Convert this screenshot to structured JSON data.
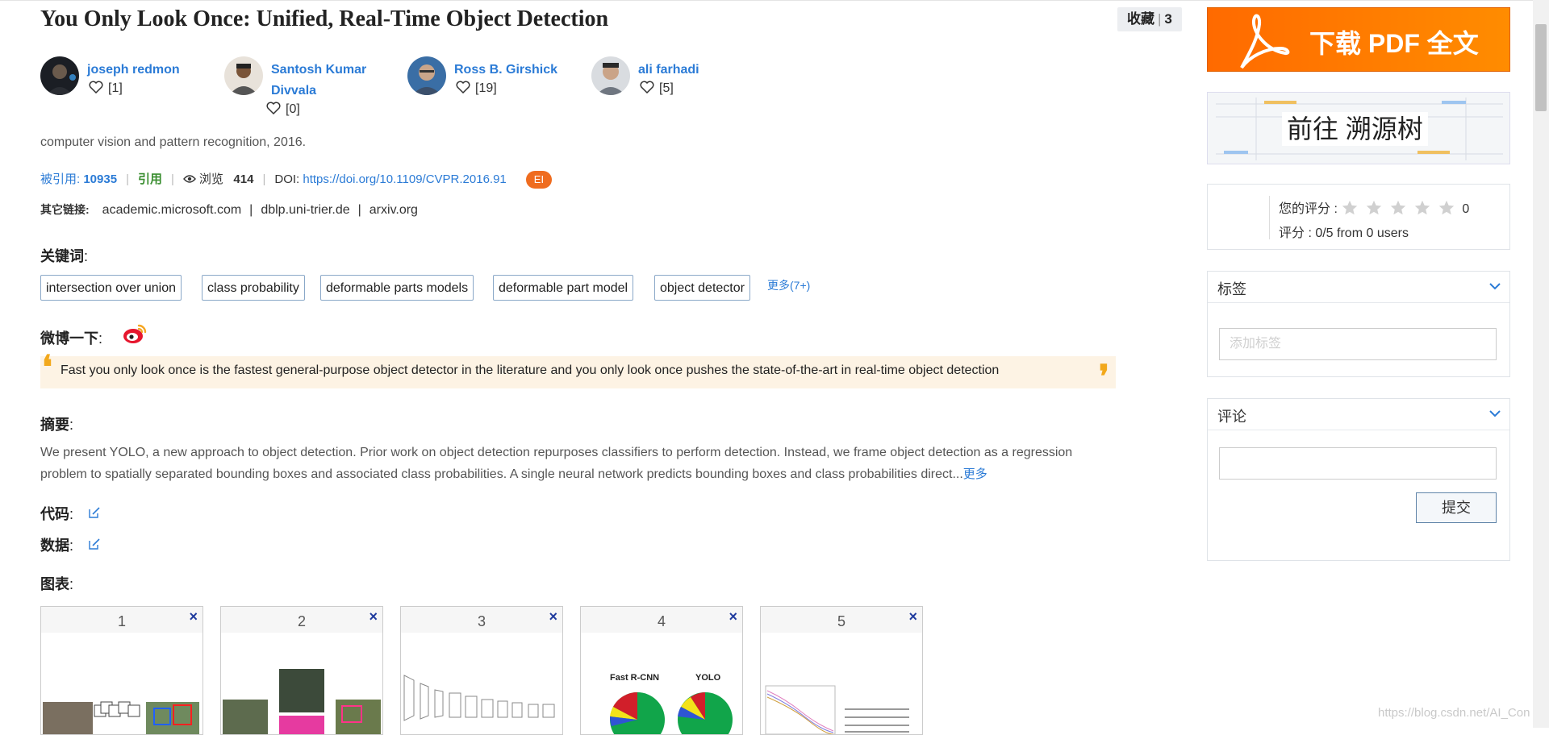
{
  "paper": {
    "title": "You Only Look Once: Unified, Real-Time Object Detection",
    "venue": "computer vision and pattern recognition, 2016."
  },
  "favorite": {
    "label": "收藏",
    "separator": "|",
    "count": "3"
  },
  "authors": [
    {
      "name_line1": "joseph redmon",
      "name_line2": "",
      "likes": "[1]"
    },
    {
      "name_line1": "Santosh Kumar",
      "name_line2": "Divvala",
      "likes": "[0]"
    },
    {
      "name_line1": "Ross B. Girshick",
      "name_line2": "",
      "likes": "[19]"
    },
    {
      "name_line1": "ali farhadi",
      "name_line2": "",
      "likes": "[5]"
    }
  ],
  "meta": {
    "cited_label": "被引用:",
    "cited_count": "10935",
    "cite_label": "引用",
    "views_label": "浏览",
    "views_count": "414",
    "doi_label": "DOI:",
    "doi_url": "https://doi.org/10.1109/CVPR.2016.91",
    "index_badge": "EI",
    "separator": "|"
  },
  "other_links": {
    "label": "其它链接:",
    "items": [
      "academic.microsoft.com",
      "dblp.uni-trier.de",
      "arxiv.org"
    ],
    "separator": "|"
  },
  "keywords": {
    "label": "关键词",
    "items": [
      "intersection over union",
      "class probability",
      "deformable parts models",
      "deformable part model",
      "object detector"
    ],
    "more": "更多(7+)"
  },
  "weibo": {
    "label": "微博一下",
    "icon": "weibo-icon",
    "quote": "Fast you only look once is the fastest general-purpose object detector in the literature and you only look once pushes the state-of-the-art in real-time object detection",
    "open_mark": "❛",
    "close_mark": "❜"
  },
  "abstract": {
    "label": "摘要",
    "line1": "We present YOLO, a new approach to object detection. Prior work on object detection repurposes classifiers to perform detection. Instead, we frame object detection as a regression",
    "line2": "problem to spatially separated bounding boxes and associated class probabilities. A single neural network predicts bounding boxes and class probabilities direct...",
    "more": "更多"
  },
  "code": {
    "label": "代码"
  },
  "dataset": {
    "label": "数据"
  },
  "figures": {
    "label": "图表",
    "close_glyph": "×",
    "items": [
      "1",
      "2",
      "3",
      "4",
      "5"
    ],
    "fig4": {
      "left_label": "Fast R-CNN",
      "right_label": "YOLO"
    }
  },
  "colon": ":",
  "sidebar": {
    "pdf_button": "下载 PDF 全文",
    "source_tree": "前往 溯源树",
    "rating": {
      "your_label": "您的评分 :",
      "your_value": "0",
      "summary": "评分 : 0/5 from 0 users",
      "stars": 5
    },
    "tags": {
      "title": "标签",
      "placeholder": "添加标签"
    },
    "comments": {
      "title": "评论",
      "submit": "提交"
    }
  },
  "watermark": "https://blog.csdn.net/AI_Con",
  "colors": {
    "link": "#2b7bd6",
    "accent_orange": "#ff7a00",
    "badge": "#ef6c1f",
    "cite_green": "#3a8e30",
    "quote_bg": "#fdf3e4"
  }
}
